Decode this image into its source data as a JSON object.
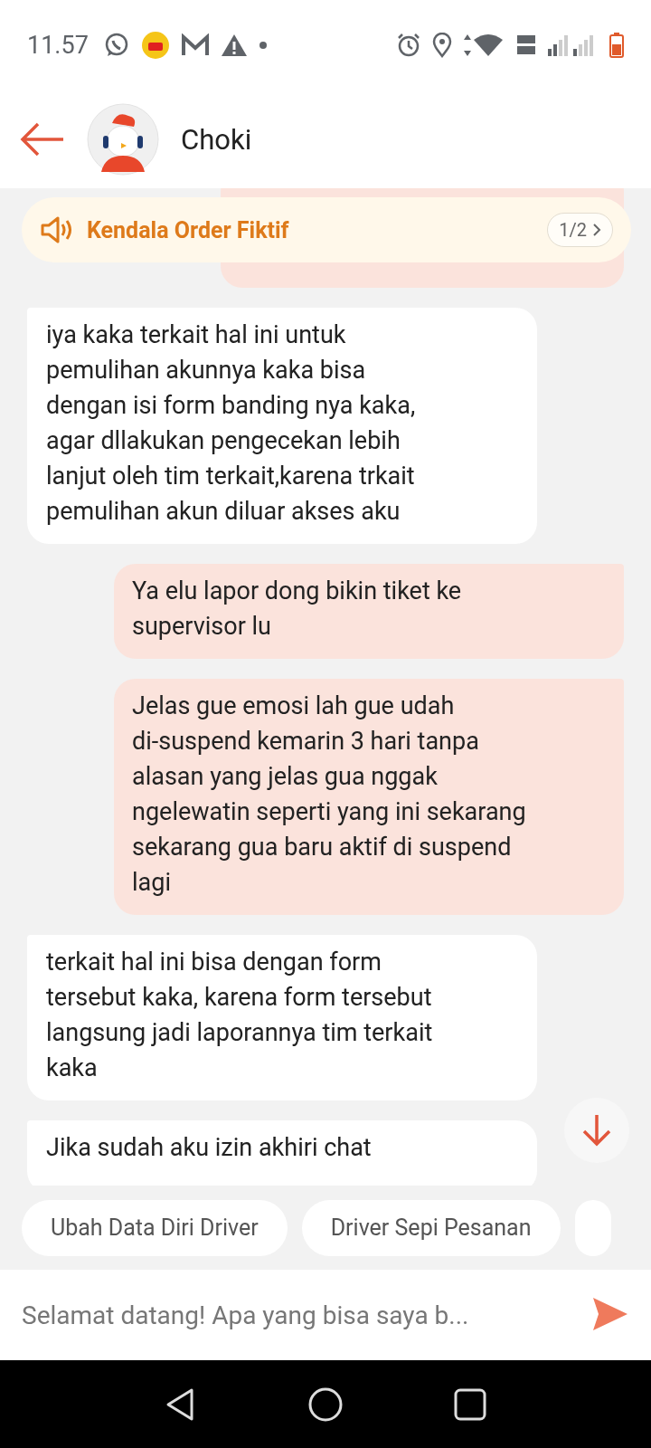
{
  "status_bar": {
    "time": "11.57"
  },
  "header": {
    "title": "Choki"
  },
  "announcement": {
    "text": "Kendala Order Fiktif",
    "pager": "1/2"
  },
  "messages": [
    {
      "kind": "outgoing_hidden"
    },
    {
      "kind": "incoming",
      "text": "iya kaka terkait hal ini untuk\npemulihan akunnya kaka bisa\ndengan isi form banding nya kaka,\nagar dllakukan pengecekan lebih\nlanjut oleh tim terkait,karena trkait\npemulihan akun diluar akses aku"
    },
    {
      "kind": "outgoing",
      "text": "Ya elu lapor dong bikin tiket ke\nsupervisor lu"
    },
    {
      "kind": "outgoing",
      "text": "Jelas gue emosi lah gue udah\ndi-suspend kemarin 3 hari tanpa\nalasan yang jelas gua nggak\nngelewatin seperti yang ini sekarang\nsekarang gua baru aktif di suspend\nlagi"
    },
    {
      "kind": "incoming",
      "text": "terkait hal ini bisa dengan form\ntersebut kaka, karena form tersebut\nlangsung jadi laporannya tim terkait\nkaka"
    },
    {
      "kind": "incoming_cut",
      "text": "Jika sudah aku izin akhiri chat"
    }
  ],
  "quick_replies": [
    "Ubah Data Diri Driver",
    "Driver Sepi Pesanan"
  ],
  "input": {
    "placeholder": "Selamat datang! Apa yang bisa saya b..."
  }
}
